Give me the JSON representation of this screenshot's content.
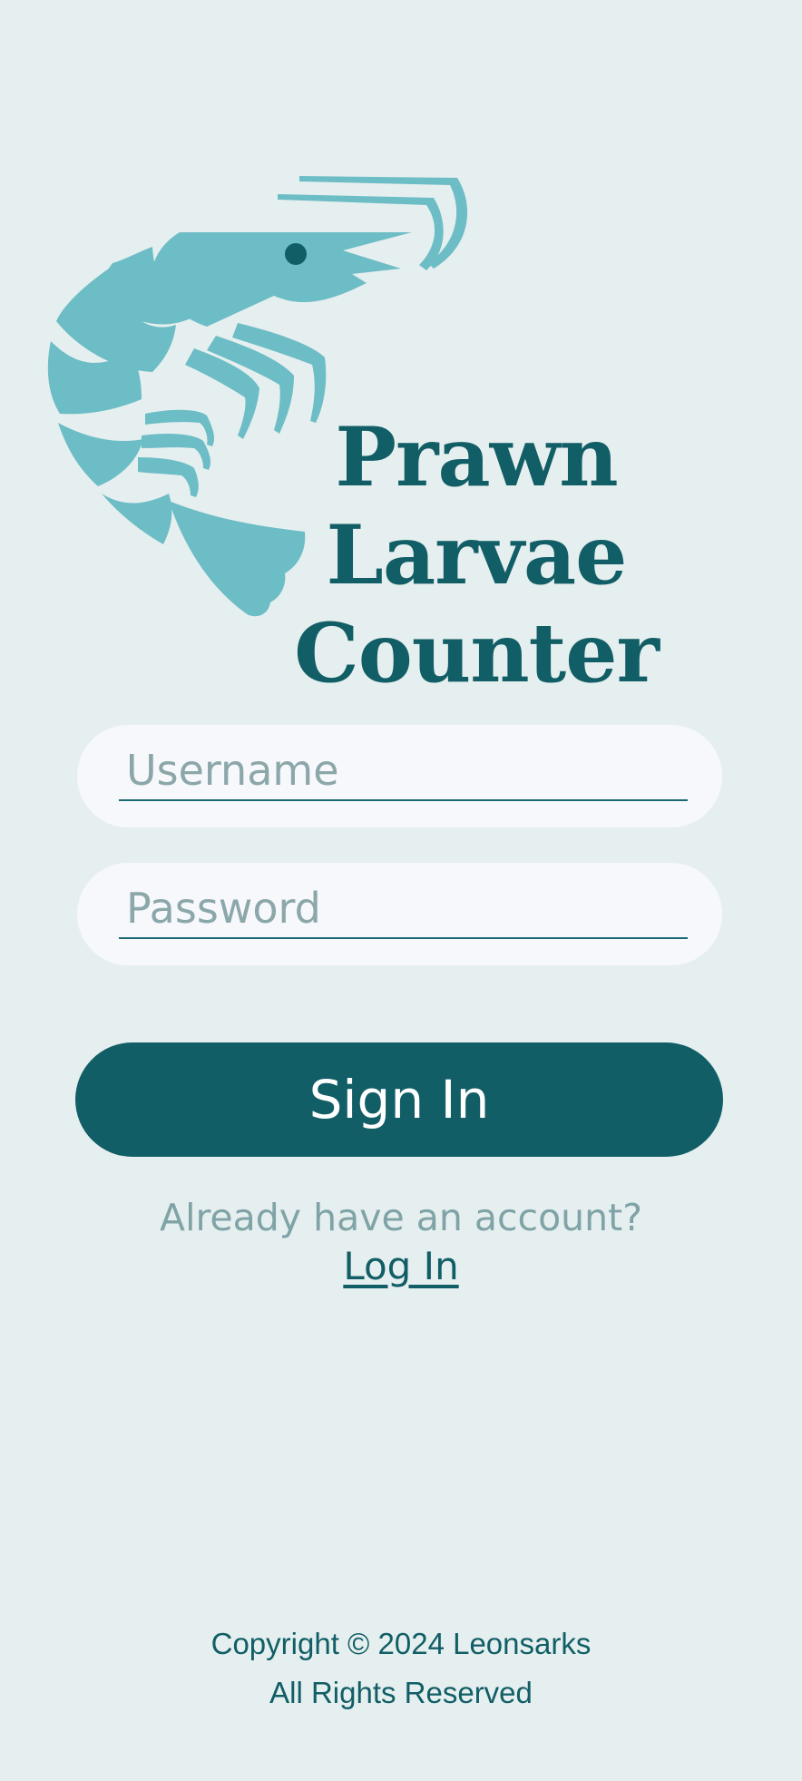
{
  "app": {
    "title_line1": "Prawn Larvae",
    "title_line2": "Counter",
    "logo_icon": "prawn-icon"
  },
  "form": {
    "username_placeholder": "Username",
    "username_value": "",
    "password_placeholder": "Password",
    "password_value": "",
    "signin_label": "Sign In"
  },
  "account": {
    "prompt": "Already have an account?",
    "login_link": "Log In"
  },
  "footer": {
    "copyright": "Copyright © 2024 Leonsarks",
    "rights": "All Rights Reserved"
  },
  "colors": {
    "background": "#E6EFEF",
    "primary": "#115E66",
    "prawn": "#6DBDC6",
    "field": "#F7F8FC",
    "muted_text": "#7FA3A6"
  }
}
